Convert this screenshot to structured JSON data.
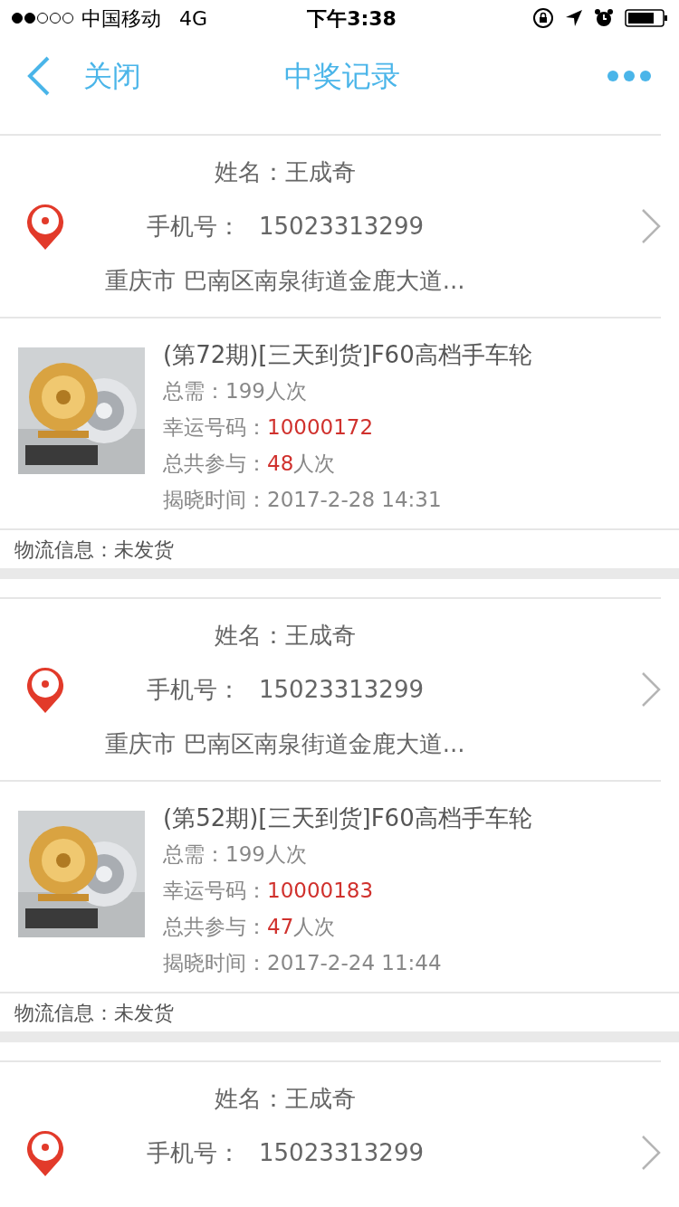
{
  "status_bar": {
    "carrier": "中国移动",
    "network": "4G",
    "time": "下午3:38"
  },
  "nav": {
    "back": "关闭",
    "title": "中奖记录"
  },
  "records": [
    {
      "name_label": "姓名：",
      "name": "王成奇",
      "phone_label": "手机号：",
      "phone": "15023313299",
      "address": "重庆市 巴南区南泉街道金鹿大道...",
      "product": {
        "title": "(第72期)[三天到货]F60高档手车轮",
        "total_label": "总需：",
        "total": "199人次",
        "lucky_label": "幸运号码：",
        "lucky": "10000172",
        "joined_label": "总共参与：",
        "joined_count": "48",
        "joined_unit": "人次",
        "time_label": "揭晓时间：",
        "time": "2017-2-28 14:31"
      },
      "logistics_label": "物流信息：",
      "logistics": "未发货"
    },
    {
      "name_label": "姓名：",
      "name": "王成奇",
      "phone_label": "手机号：",
      "phone": "15023313299",
      "address": "重庆市 巴南区南泉街道金鹿大道...",
      "product": {
        "title": "(第52期)[三天到货]F60高档手车轮",
        "total_label": "总需：",
        "total": "199人次",
        "lucky_label": "幸运号码：",
        "lucky": "10000183",
        "joined_label": "总共参与：",
        "joined_count": "47",
        "joined_unit": "人次",
        "time_label": "揭晓时间：",
        "time": "2017-2-24 11:44"
      },
      "logistics_label": "物流信息：",
      "logistics": "未发货"
    },
    {
      "name_label": "姓名：",
      "name": "王成奇",
      "phone_label": "手机号：",
      "phone": "15023313299"
    }
  ]
}
